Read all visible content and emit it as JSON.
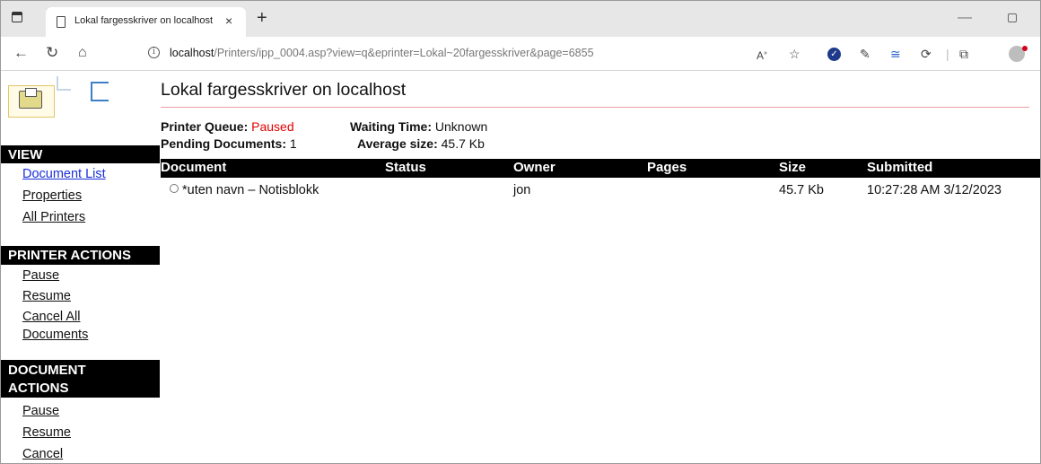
{
  "browser": {
    "tab_title": "Lokal fargesskriver on localhost",
    "tab_close": "×",
    "new_tab": "+",
    "url_host": "localhost",
    "url_rest": "/Printers/ipp_0004.asp?view=q&eprinter=Lokal~20fargesskriver&page=6855",
    "icons": [
      "back-icon",
      "refresh-icon",
      "home-icon",
      "info-icon",
      "read-aloud-icon",
      "favorite-icon",
      "extension-icon",
      "eyedropper-icon",
      "collections-icon",
      "settings-icon",
      "profile-icon"
    ]
  },
  "page": {
    "title": "Lokal fargesskriver on localhost",
    "printer_queue_label": "Printer Queue:",
    "printer_queue_value": "Paused",
    "waiting_time_label": "Waiting Time:",
    "waiting_time_value": "Unknown",
    "pending_label": "Pending Documents:",
    "pending_value": "1",
    "avg_size_label": "Average size:",
    "avg_size_value": "45.7 Kb"
  },
  "sidebar": {
    "view_header": "VIEW",
    "view_links": [
      "Document List",
      "Properties",
      "All Printers"
    ],
    "printer_actions_header": "PRINTER ACTIONS",
    "printer_actions": [
      "Pause",
      "Resume",
      "Cancel All",
      "Documents"
    ],
    "document_actions_header_1": "DOCUMENT",
    "document_actions_header_2": "ACTIONS",
    "document_actions": [
      "Pause",
      "Resume",
      "Cancel"
    ]
  },
  "table": {
    "headers": [
      "Document",
      "Status",
      "Owner",
      "Pages",
      "Size",
      "Submitted"
    ],
    "rows": [
      [
        "*uten navn – Notisblokk",
        "",
        "jon",
        "",
        "45.7 Kb",
        "10:27:28 AM 3/12/2023"
      ]
    ]
  },
  "colors": {
    "paused": "#e00000",
    "link_active": "#1a2fd8",
    "header_bg": "#000000",
    "title_rule": "#e8a0a6"
  }
}
